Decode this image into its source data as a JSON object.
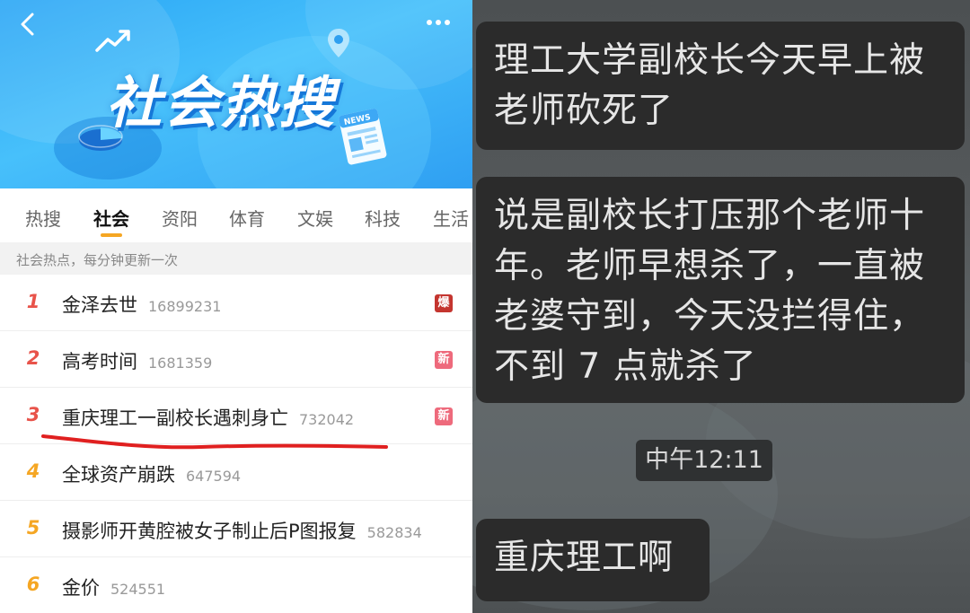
{
  "left": {
    "banner": {
      "title": "社会热搜"
    },
    "tabs": [
      {
        "label": "热搜",
        "active": false
      },
      {
        "label": "社会",
        "active": true
      },
      {
        "label": "资阳",
        "active": false
      },
      {
        "label": "体育",
        "active": false
      },
      {
        "label": "文娱",
        "active": false
      },
      {
        "label": "科技",
        "active": false
      },
      {
        "label": "生活",
        "active": false
      }
    ],
    "subtitle": "社会热点，每分钟更新一次",
    "rows": [
      {
        "rank": "1",
        "title": "金泽去世",
        "count": "16899231",
        "badge": "爆"
      },
      {
        "rank": "2",
        "title": "高考时间",
        "count": "1681359",
        "badge": "新"
      },
      {
        "rank": "3",
        "title": "重庆理工一副校长遇刺身亡",
        "count": "732042",
        "badge": "新"
      },
      {
        "rank": "4",
        "title": "全球资产崩跌",
        "count": "647594",
        "badge": ""
      },
      {
        "rank": "5",
        "title": "摄影师开黄腔被女子制止后P图报复",
        "count": "582834",
        "badge": ""
      },
      {
        "rank": "6",
        "title": "金价",
        "count": "524551",
        "badge": ""
      }
    ],
    "colors": {
      "rank_top": "#e8534a",
      "rank_mid": "#f5a623",
      "badge_hot": "#c4352f",
      "badge_new": "#ee6a7c",
      "underline": "#e02020"
    }
  },
  "right": {
    "messages": [
      {
        "text": "理工大学副校长今天早上被老师砍死了"
      },
      {
        "text": "说是副校长打压那个老师十年。老师早想杀了，一直被老婆守到，今天没拦得住，不到 7 点就杀了"
      },
      {
        "text": "重庆理工啊"
      }
    ],
    "timestamp": "中午12:11"
  }
}
